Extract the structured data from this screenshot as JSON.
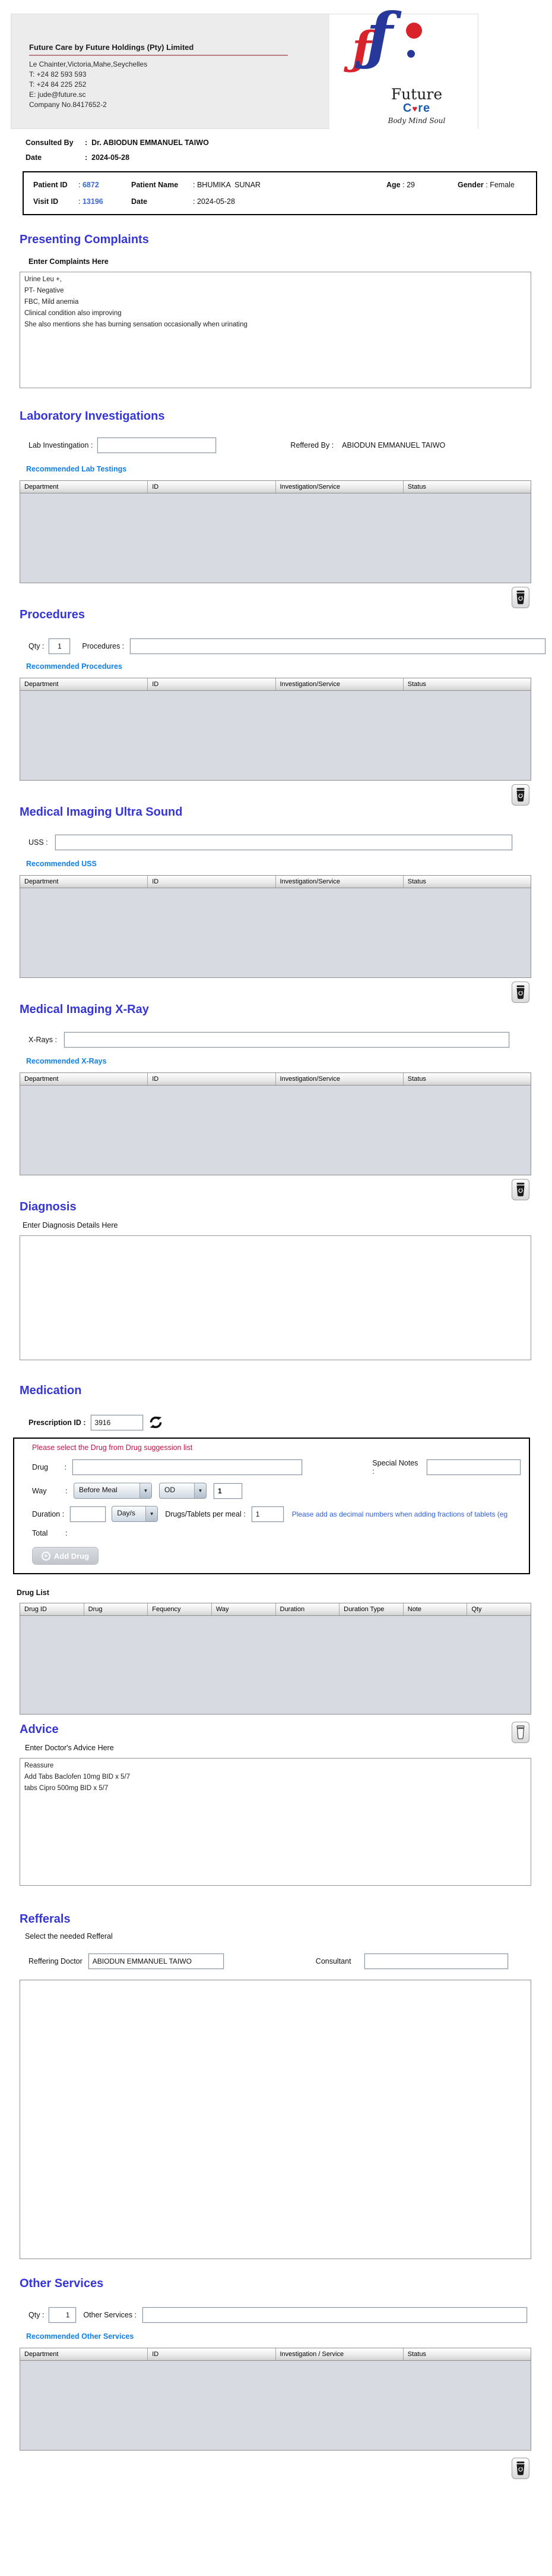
{
  "colors": {
    "heading": "#3535d8",
    "link": "#0e7fe8",
    "alert_red": "#c8104a",
    "helper_blue": "#2f5fe0",
    "id_blue": "#3a66d6",
    "logo_blue": "#27389b",
    "logo_red": "#d8232a",
    "care_blue": "#1d5cb0",
    "table_body": "#d7dae1"
  },
  "icons": {
    "heart": "♥",
    "dropdown_arrow": "▼",
    "plus": "+"
  },
  "ui": {
    "colon": ":"
  },
  "header": {
    "company_name": "Future Care by Future Holdings (Pty) Limited",
    "address": "Le Chainter,Victoria,Mahe,Seychelles",
    "phone1": "T: +24  82 593 593",
    "phone2": "T: +24  84 225 252",
    "email": "E: jude@future.sc",
    "company_no": "Company No.8417652-2",
    "logo": {
      "f_glyph": "ƒ",
      "word1": "Future",
      "care_c": "C",
      "care_rest": "re",
      "tagline": "Body Mind Soul"
    }
  },
  "consult": {
    "consulted_by_label": "Consulted By",
    "consulted_by_value": "Dr.  ABIODUN EMMANUEL TAIWO",
    "date_label": "Date",
    "date_value": "2024-05-28"
  },
  "patient": {
    "patient_id_label": "Patient ID",
    "patient_id": "6872",
    "patient_name_label": "Patient Name",
    "patient_name": "BHUMIKA  SUNAR",
    "age_label": "Age",
    "age": "29",
    "gender_label": "Gender",
    "gender": "Female",
    "visit_id_label": "Visit ID",
    "visit_id": "13196",
    "visit_date_label": "Date",
    "visit_date": "2024-05-28"
  },
  "complaints": {
    "title": "Presenting Complaints",
    "label": "Enter Complaints Here",
    "text": "Urine Leu +,\nPT- Negative\nFBC, Mild anemia\nClinical condition also improving\nShe also mentions she has burning sensation occasionally when urinating"
  },
  "lab": {
    "title": "Laboratory  Investigations",
    "input_label": "Lab Investingation :",
    "reffered_by_label": "Reffered By :",
    "reffered_by_value": "ABIODUN EMMANUEL TAIWO",
    "link": "Recommended Lab Testings",
    "columns": [
      "Department",
      "ID",
      "Investigation/Service",
      "Status"
    ]
  },
  "procedures": {
    "title": "Procedures",
    "qty_label": "Qty :",
    "qty": "1",
    "input_label": "Procedures :",
    "link": "Recommended Procedures",
    "columns": [
      "Department",
      "ID",
      "Investigation/Service",
      "Status"
    ]
  },
  "uss": {
    "title": "Medical Imaging Ultra Sound",
    "input_label": "USS :",
    "link": "Recommended USS",
    "columns": [
      "Department",
      "ID",
      "Investigation/Service",
      "Status"
    ]
  },
  "xray": {
    "title": "Medical Imaging X-Ray",
    "input_label": "X-Rays :",
    "link": "Recommended X-Rays",
    "columns": [
      "Department",
      "ID",
      "Investigation/Service",
      "Status"
    ]
  },
  "diagnosis": {
    "title": "Diagnosis",
    "label": "Enter Diagnosis Details Here"
  },
  "medication": {
    "title": "Medication",
    "prescription_id_label": "Prescription ID :",
    "prescription_id": "3916",
    "panel_note": "Please select the Drug from Drug suggession list",
    "drug_label": "Drug",
    "special_notes_label": "Special Notes  :",
    "way_label": "Way",
    "way_value": "Before Meal",
    "frequency_value": "OD",
    "way_qty": "1",
    "duration_label": "Duration :",
    "duration_unit": "Day/s",
    "per_meal_label": "Drugs/Tablets per meal :",
    "per_meal_qty": "1",
    "fraction_note": "Please add as decimal numbers when adding fractions of tablets (eg",
    "total_label": "Total",
    "add_drug_label": "Add Drug",
    "drug_list_label": "Drug List",
    "columns": [
      "Drug ID",
      "Drug",
      "Fequency",
      "Way",
      "Duration",
      "Duration Type",
      "Note",
      "Qty"
    ]
  },
  "advice": {
    "title": "Advice",
    "label": "Enter Doctor's Advice Here",
    "text": "Reassure\nAdd Tabs Baclofen 10mg BID x 5/7\ntabs Cipro 500mg BID x 5/7"
  },
  "referrals": {
    "title": "Refferals",
    "label": "Select the needed Refferal",
    "doctor_label": "Reffering Doctor",
    "doctor_value": "ABIODUN EMMANUEL TAIWO",
    "consultant_label": "Consultant"
  },
  "other_services": {
    "title": "Other Services",
    "qty_label": "Qty :",
    "qty": "1",
    "input_label": "Other Services :",
    "link": "Recommended Other Services",
    "columns": [
      "Department",
      "ID",
      "Investigation / Service",
      "Status"
    ]
  }
}
